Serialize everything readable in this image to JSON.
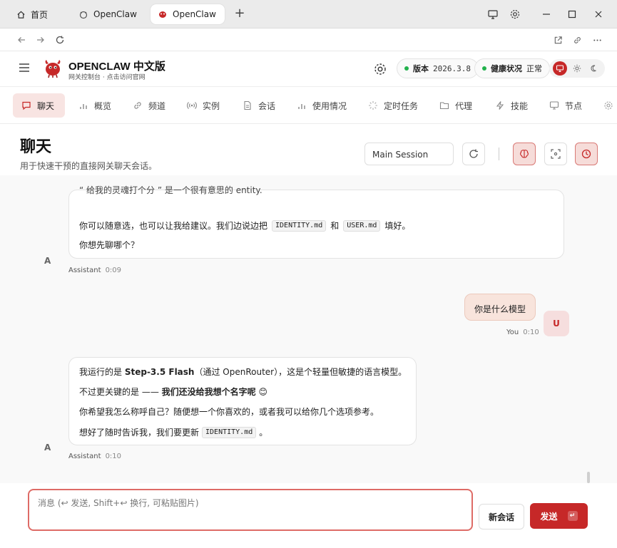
{
  "browser": {
    "tabs": [
      {
        "label": "首页",
        "icon": "home-icon"
      },
      {
        "label": "OpenClaw",
        "icon": "claw-icon"
      },
      {
        "label": "OpenClaw",
        "icon": "lobster-icon",
        "active": true
      }
    ],
    "new_tab": "+"
  },
  "header": {
    "brand": "OPENCLAW 中文版",
    "brand_sub": "网关控制台 · 点击访问官网",
    "version_label": "版本",
    "version_value": "2026.3.8",
    "health_label": "健康状况",
    "health_value": "正常",
    "status_color": "#22b14c",
    "accent_color": "#c62828"
  },
  "nav": {
    "tabs": [
      {
        "label": "聊天",
        "icon": "chat-icon",
        "active": true
      },
      {
        "label": "概览",
        "icon": "bar-chart-icon"
      },
      {
        "label": "频道",
        "icon": "link-icon"
      },
      {
        "label": "实例",
        "icon": "broadcast-icon"
      },
      {
        "label": "会话",
        "icon": "document-icon"
      },
      {
        "label": "使用情况",
        "icon": "bar-chart-icon"
      },
      {
        "label": "定时任务",
        "icon": "loader-icon"
      },
      {
        "label": "代理",
        "icon": "folder-icon"
      },
      {
        "label": "技能",
        "icon": "bolt-icon"
      },
      {
        "label": "节点",
        "icon": "monitor-icon"
      }
    ]
  },
  "page": {
    "title": "聊天",
    "subtitle": "用于快速干预的直接网关聊天会话。",
    "session": "Main Session"
  },
  "messages": {
    "m1": {
      "top_fragment": "“ 给我的灵魂打个分 ” 是一个很有意思的 entity.",
      "line1_a": "你可以随意选，也可以让我给建议。我们边说边把",
      "code1": "IDENTITY.md",
      "line1_b": "和",
      "code2": "USER.md",
      "line1_c": "填好。",
      "line2": "你想先聊哪个？",
      "avatar": "A",
      "sender": "Assistant",
      "time": "0:09"
    },
    "m2": {
      "text": "你是什么模型",
      "avatar": "U",
      "sender": "You",
      "time": "0:10"
    },
    "m3": {
      "l1_a": "我运行的是",
      "l1_bold": "Step-3.5 Flash",
      "l1_b": "（通过 OpenRouter），这是个轻量但敏捷的语言模型。",
      "l2_a": "不过更关键的是 ——",
      "l2_bold": "我们还没给我想个名字呢",
      "l2_emoji": "😊",
      "l3": "你希望我怎么称呼自己？随便想一个你喜欢的，或者我可以给你几个选项参考。",
      "l4_a": "想好了随时告诉我，我们要更新",
      "l4_code": "IDENTITY.md",
      "l4_b": "。",
      "avatar": "A",
      "sender": "Assistant",
      "time": "0:10"
    }
  },
  "composer": {
    "placeholder": "消息 (↩ 发送, Shift+↩ 换行, 可粘贴图片)",
    "new_chat": "新会话",
    "send": "发送",
    "send_kbd": "↵"
  }
}
